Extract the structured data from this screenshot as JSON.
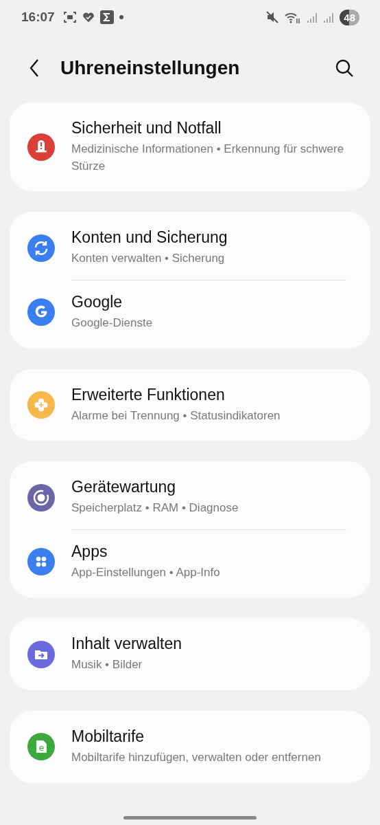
{
  "status_bar": {
    "time": "16:07",
    "battery": "48"
  },
  "header": {
    "title": "Uhreneinstellungen"
  },
  "groups": [
    {
      "items": [
        {
          "kind": "safety",
          "color": "#d9403a",
          "title": "Sicherheit und Notfall",
          "subtitle": "Medizinische Informationen • Erkennung für schwere Stürze"
        }
      ]
    },
    {
      "items": [
        {
          "kind": "sync",
          "color": "#3b7ef0",
          "title": "Konten und Sicherung",
          "subtitle": "Konten verwalten • Sicherung"
        },
        {
          "kind": "google",
          "color": "#3b7ef0",
          "title": "Google",
          "subtitle": "Google-Dienste"
        }
      ]
    },
    {
      "items": [
        {
          "kind": "features",
          "color": "#f7b84b",
          "title": "Erweiterte Funktionen",
          "subtitle": "Alarme bei Trennung • Statusindikatoren"
        }
      ]
    },
    {
      "items": [
        {
          "kind": "care",
          "color": "#6b66a8",
          "title": "Gerätewartung",
          "subtitle": "Speicherplatz • RAM • Diagnose"
        },
        {
          "kind": "apps",
          "color": "#3b7ef0",
          "title": "Apps",
          "subtitle": "App-Einstellungen • App-Info"
        }
      ]
    },
    {
      "items": [
        {
          "kind": "content",
          "color": "#6a6ade",
          "title": "Inhalt verwalten",
          "subtitle": "Musik • Bilder"
        }
      ]
    },
    {
      "items": [
        {
          "kind": "plans",
          "color": "#3da93d",
          "glyph": "e",
          "title": "Mobiltarife",
          "subtitle": "Mobiltarife hinzufügen, verwalten oder entfernen"
        }
      ]
    }
  ]
}
